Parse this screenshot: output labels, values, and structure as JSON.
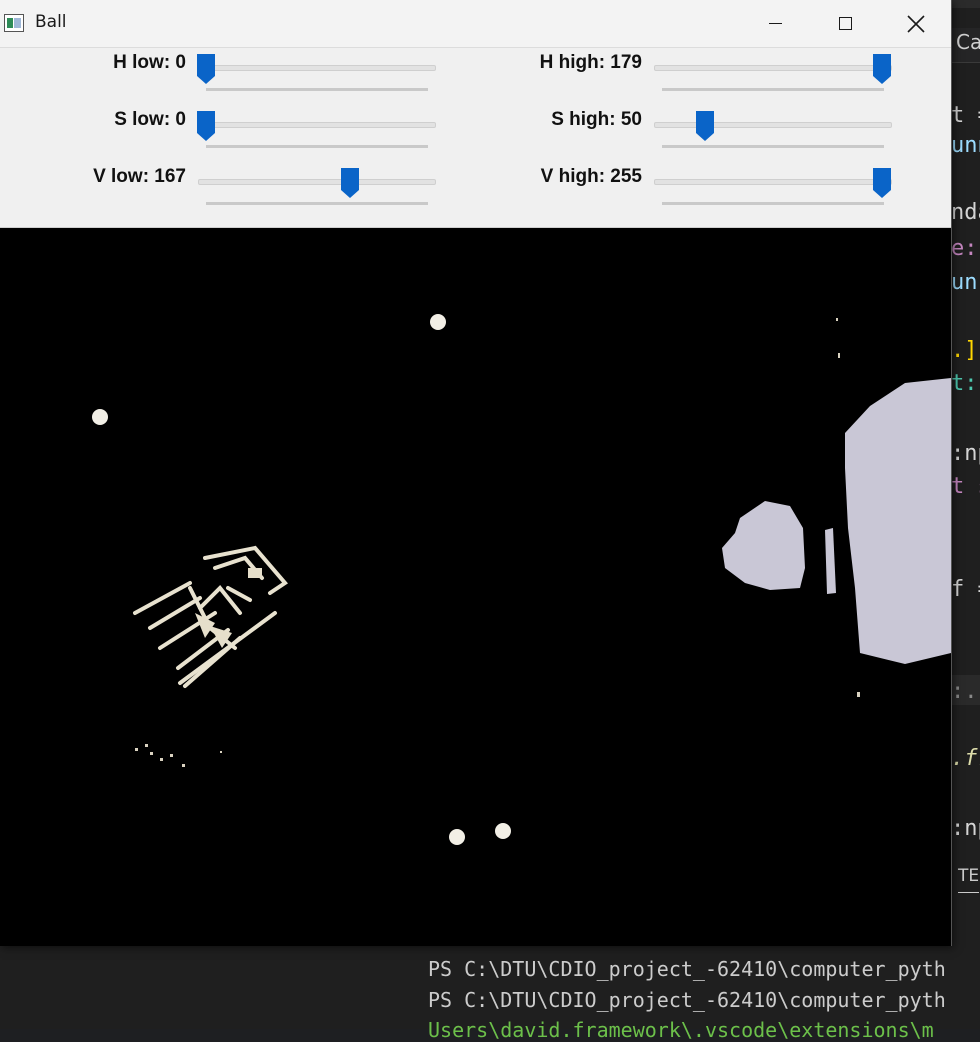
{
  "window": {
    "title": "Ball"
  },
  "trackbars": [
    {
      "label": "H low: 0",
      "value": 0,
      "max": 179
    },
    {
      "label": "H high: 179",
      "value": 179,
      "max": 179
    },
    {
      "label": "S low: 0",
      "value": 0,
      "max": 255
    },
    {
      "label": "S high: 50",
      "value": 50,
      "max": 255
    },
    {
      "label": "V low: 167",
      "value": 167,
      "max": 255
    },
    {
      "label": "V high: 255",
      "value": 255,
      "max": 255
    }
  ],
  "background_editor": {
    "tab_text": "Ca",
    "code_fragments": [
      "t =",
      "unn",
      "nda",
      "e:",
      "unr",
      ".]",
      "t:|N",
      ":np",
      "t s",
      "f =",
      ":..",
      ".fr",
      ":np"
    ],
    "panel_tab": "TE",
    "terminal_lines": [
      "PS C:\\DTU\\CDIO_project_-62410\\computer_pyth",
      "PS C:\\DTU\\CDIO_project_-62410\\computer_pyth",
      "Users\\david.framework\\.vscode\\extensions\\m"
    ]
  },
  "colors": {
    "thumb": "#0a64c8",
    "mask_white": "#f2efe6",
    "mask_lavender": "#c9c7d6"
  }
}
